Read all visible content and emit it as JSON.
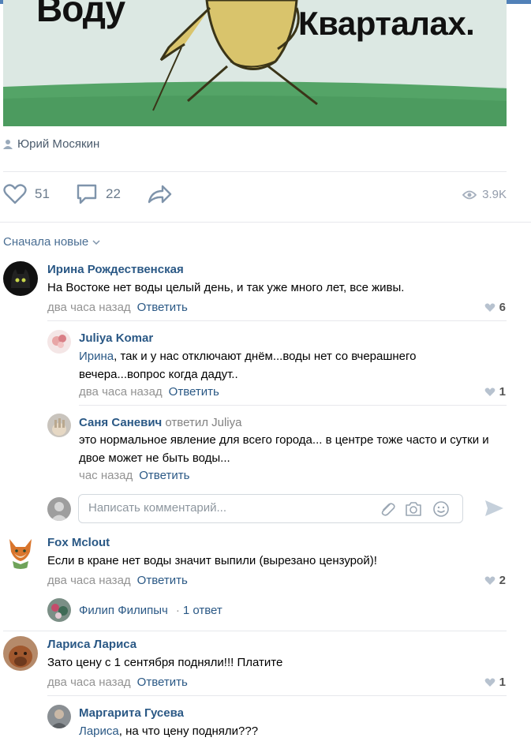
{
  "post": {
    "image_text_left": "Воду",
    "image_text_right": "Кварталах.",
    "author": "Юрий Мосякин",
    "likes": "51",
    "comments": "22",
    "views": "3.9K"
  },
  "sort_label": "Сначала новые",
  "comments": [
    {
      "name": "Ирина Рождественская",
      "text": "На Востоке нет воды целый день, и так уже много лет, все живы.",
      "time": "два часа назад",
      "reply": "Ответить",
      "likes": "6"
    },
    {
      "name": "Juliya Komar",
      "mention": "Ирина",
      "text": ", так и у нас отключают днём...воды нет со вчерашнего вечера...вопрос когда дадут..",
      "time": "два часа назад",
      "reply": "Ответить",
      "likes": "1"
    },
    {
      "name": "Саня Саневич",
      "replied_to": "ответил Juliya",
      "text": "это нормальное явление для всего города... в центре тоже часто и сутки и двое может не быть воды...",
      "time": "час назад",
      "reply": "Ответить"
    },
    {
      "name": "Fox Mclout",
      "text": "Если в кране нет воды значит выпили (вырезано цензурой)!",
      "time": "два часа назад",
      "reply": "Ответить",
      "likes": "2"
    },
    {
      "name": "Лариса Лариса",
      "text": "Зато цену с 1 сентября подняли!!! Платите",
      "time": "два часа назад",
      "reply": "Ответить",
      "likes": "1"
    },
    {
      "name": "Маргарита Гусева",
      "mention": "Лариса",
      "text": ", на что цену подняли???"
    }
  ],
  "comment_input": {
    "placeholder": "Написать комментарий..."
  },
  "thread": {
    "name": "Филип Филипыч",
    "separator": "·",
    "count": "1 ответ"
  },
  "icons": {
    "like": "heart-icon",
    "comment": "comment-bubble-icon",
    "share": "share-arrow-icon",
    "views": "eye-icon",
    "attach": "paperclip-icon",
    "photo": "camera-icon",
    "emoji": "smile-icon",
    "send": "send-icon"
  },
  "colors": {
    "link": "#2a5885",
    "secondary": "#939393",
    "accent": "#5181b8"
  }
}
